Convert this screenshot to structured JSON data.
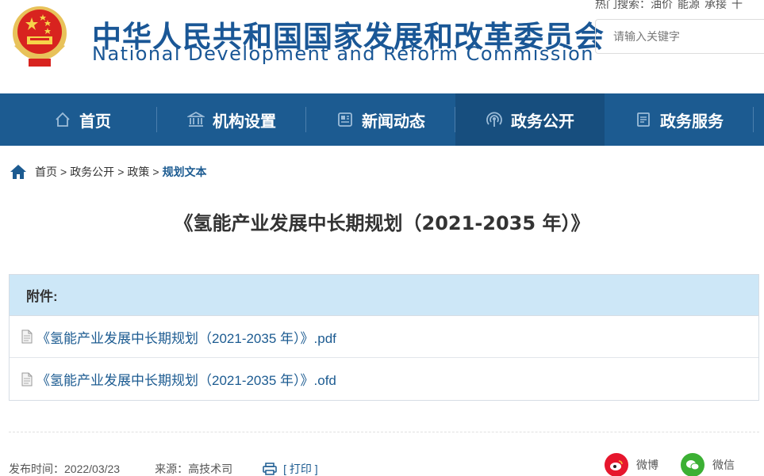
{
  "header": {
    "title_cn": "中华人民共和国国家发展和改革委员会",
    "title_en": "National Development and Reform Commission",
    "hot_search_label": "热门搜索：",
    "hot_search_terms": [
      "油价",
      "能源",
      "承接",
      "十"
    ],
    "search_placeholder": "请输入关键字"
  },
  "nav": {
    "items": [
      {
        "label": "首页",
        "icon": "home-icon"
      },
      {
        "label": "机构设置",
        "icon": "institution-icon"
      },
      {
        "label": "新闻动态",
        "icon": "news-icon"
      },
      {
        "label": "政务公开",
        "icon": "broadcast-icon",
        "active": true
      },
      {
        "label": "政务服务",
        "icon": "document-icon"
      }
    ]
  },
  "breadcrumb": {
    "items": [
      "首页",
      "政务公开",
      "政策",
      "规划文本"
    ],
    "separator": ">"
  },
  "article": {
    "title": "《氢能产业发展中长期规划（2021-2035 年）》"
  },
  "attachments": {
    "heading": "附件:",
    "files": [
      {
        "name": "《氢能产业发展中长期规划（2021-2035 年）》.pdf"
      },
      {
        "name": "《氢能产业发展中长期规划（2021-2035 年）》.ofd"
      }
    ]
  },
  "meta": {
    "publish_time": "发布时间：2022/03/23",
    "source": "来源：高技术司",
    "print_label": "[ 打印 ]",
    "share_weibo": "微博",
    "share_wechat": "微信"
  },
  "colors": {
    "brand_blue": "#1c5b91",
    "nav_active": "#174e7e",
    "attach_head_bg": "#cde7f7",
    "weibo_red": "#e6162d",
    "wechat_green": "#3cb034"
  }
}
